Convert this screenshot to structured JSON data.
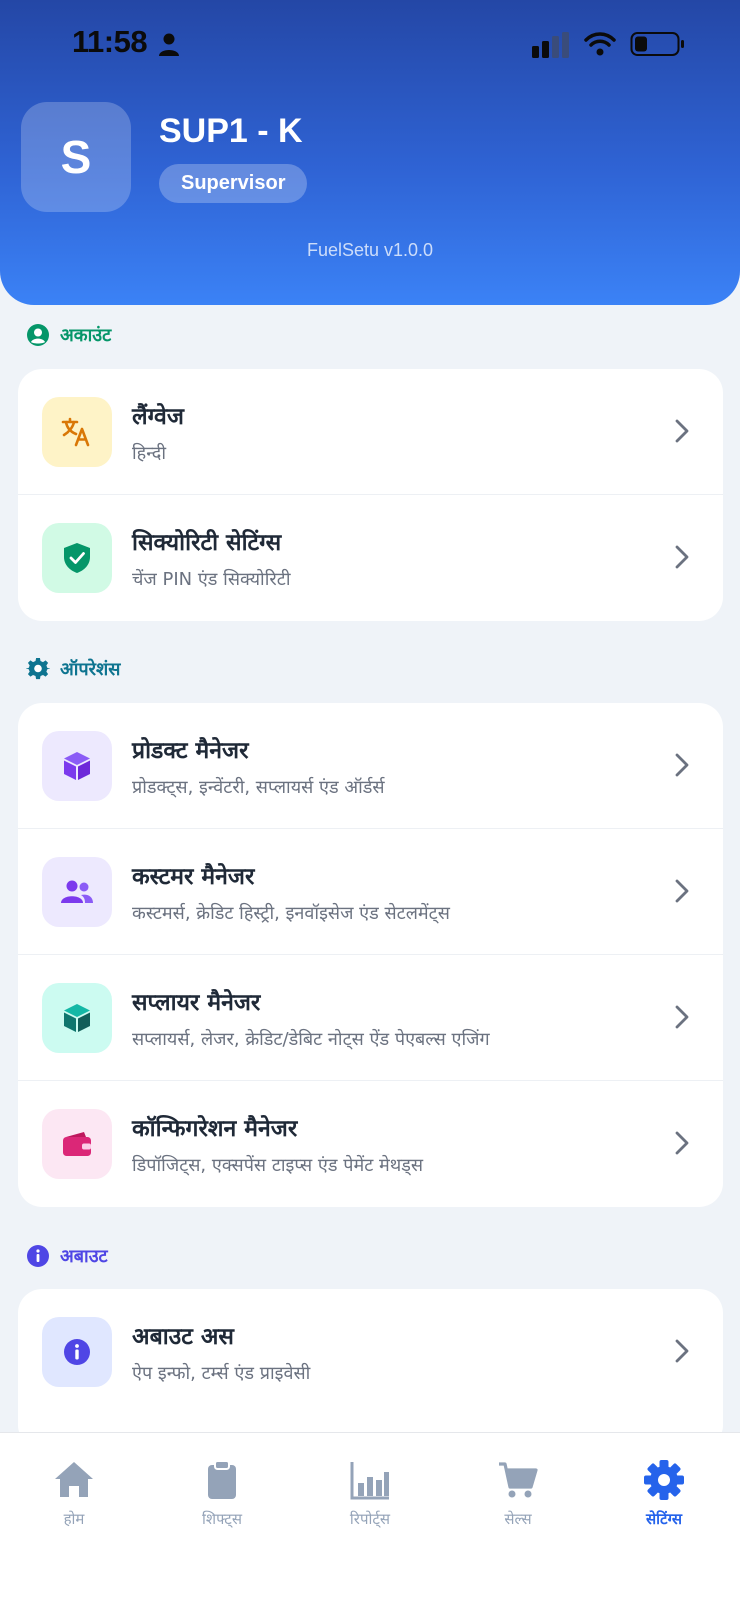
{
  "status_bar": {
    "time": "11:58"
  },
  "profile": {
    "avatar_initial": "S",
    "name": "SUP1 - K",
    "role": "Supervisor",
    "version": "FuelSetu v1.0.0"
  },
  "sections": {
    "account": {
      "label": "अकाउंट",
      "color": "#059669",
      "items": [
        {
          "title": "लैंग्वेज",
          "subtitle": "हिन्दी",
          "icon": "translate-icon",
          "icon_color": "#d97706",
          "icon_bg": "#fef3c7"
        },
        {
          "title": "सिक्योरिटी सेटिंग्स",
          "subtitle": "चेंज PIN एंड सिक्योरिटी",
          "icon": "shield-check-icon",
          "icon_color": "#059669",
          "icon_bg": "#d1fae5"
        }
      ]
    },
    "operations": {
      "label": "ऑपरेशंस",
      "color": "#0e7490",
      "items": [
        {
          "title": "प्रोडक्ट मैनेजर",
          "subtitle": "प्रोडक्ट्स, इन्वेंटरी, सप्लायर्स एंड ऑर्डर्स",
          "icon": "cube-icon",
          "icon_color": "#7c3aed",
          "icon_bg": "#ede9fe"
        },
        {
          "title": "कस्टमर मैनेजर",
          "subtitle": "कस्टमर्स, क्रेडिट हिस्ट्री, इनवॉइसेज एंड सेटलमेंट्स",
          "icon": "users-icon",
          "icon_color": "#7c3aed",
          "icon_bg": "#ede9fe"
        },
        {
          "title": "सप्लायर मैनेजर",
          "subtitle": "सप्लायर्स, लेजर, क्रेडिट/डेबिट नोट्स ऐंड पेएबल्स एजिंग",
          "icon": "box-icon",
          "icon_color": "#0f766e",
          "icon_bg": "#ccfbf1"
        },
        {
          "title": "कॉन्फिगरेशन मैनेजर",
          "subtitle": "डिपॉजिट्स, एक्सपेंस टाइप्स एंड पेमेंट मेथड्स",
          "icon": "wallet-icon",
          "icon_color": "#db2777",
          "icon_bg": "#fce7f3"
        }
      ]
    },
    "about": {
      "label": "अबाउट",
      "color": "#4f46e5",
      "items": [
        {
          "title": "अबाउट अस",
          "subtitle": "ऐप इन्फो, टर्म्स एंड प्राइवेसी",
          "icon": "info-icon",
          "icon_color": "#4f46e5",
          "icon_bg": "#e0e7ff"
        }
      ]
    }
  },
  "bottom_nav": {
    "items": [
      {
        "label": "होम",
        "icon": "home-icon"
      },
      {
        "label": "शिफ्ट्स",
        "icon": "clipboard-icon"
      },
      {
        "label": "रिपोर्ट्स",
        "icon": "bar-chart-icon"
      },
      {
        "label": "सेल्स",
        "icon": "cart-icon"
      },
      {
        "label": "सेटिंग्स",
        "icon": "gear-icon",
        "active": true
      }
    ],
    "active_color": "#2563eb",
    "inactive_color": "#94a3b8"
  }
}
